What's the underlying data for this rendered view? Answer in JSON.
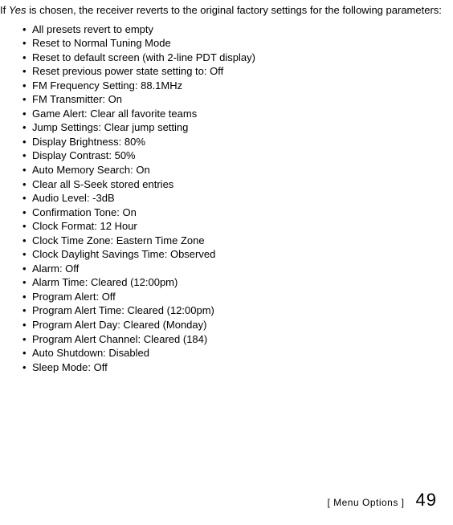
{
  "intro": {
    "prefix": "If ",
    "yes": "Yes",
    "rest": " is chosen, the receiver reverts to the original factory settings for the following parameters:"
  },
  "items": [
    "All presets revert to empty",
    "Reset to Normal Tuning Mode",
    "Reset to default screen (with 2-line PDT display)",
    "Reset previous power state setting to: Off",
    "FM Frequency Setting: 88.1MHz",
    "FM Transmitter: On",
    "Game Alert: Clear all favorite teams",
    "Jump Settings: Clear jump setting",
    "Display Brightness: 80%",
    "Display Contrast: 50%",
    "Auto Memory Search: On",
    "Clear all S-Seek stored entries",
    "Audio Level: -3dB",
    "Confirmation Tone: On",
    "Clock Format: 12 Hour",
    "Clock Time Zone: Eastern Time Zone",
    "Clock Daylight Savings Time: Observed",
    "Alarm: Off",
    "Alarm Time: Cleared (12:00pm)",
    "Program Alert: Off",
    "Program Alert Time: Cleared (12:00pm)",
    "Program Alert Day: Cleared (Monday)",
    "Program Alert Channel: Cleared (184)",
    "Auto Shutdown: Disabled",
    "Sleep Mode: Off"
  ],
  "footer": {
    "label": "[ Menu Options ]",
    "page": "49"
  }
}
